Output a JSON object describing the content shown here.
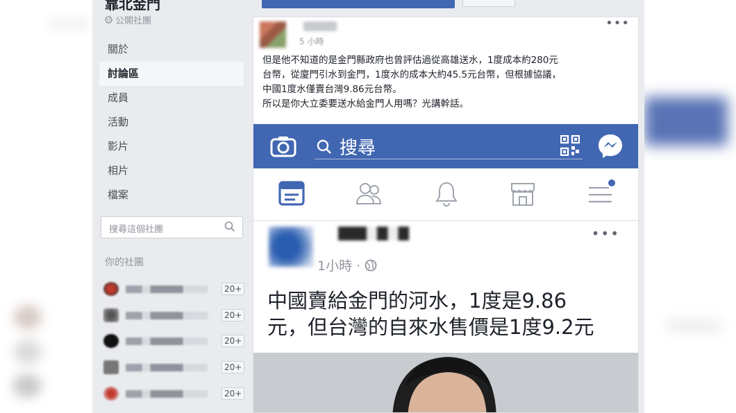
{
  "sidebar": {
    "group_title": "靠北金門",
    "group_type": "公開社團",
    "nav": [
      "關於",
      "討論區",
      "成員",
      "活動",
      "影片",
      "相片",
      "檔案"
    ],
    "search_placeholder": "搜尋這個社團",
    "your_groups_label": "你的社團",
    "groups": [
      {
        "badge": "20+"
      },
      {
        "badge": "20+"
      },
      {
        "badge": "20+"
      },
      {
        "badge": "20+"
      },
      {
        "badge": "20+"
      }
    ]
  },
  "post": {
    "time": "5 小時",
    "text": [
      "但是他不知道的是金門縣政府也曾評估過從高雄送水，1度成本約280元",
      "台幣，從廈門引水到金門，1度水的成本大約45.5元台幣，但根據協議，",
      "中國1度水僅賣台灣9.86元台幣。",
      "所以是你大立委要送水給金門人用嗎？光講幹話。"
    ]
  },
  "mobile": {
    "search_label": "搜尋",
    "post_time": "1小時 ·",
    "headline": [
      "中國賣給金門的河水，1度是9.86",
      "元，但台灣的自來水售價是1度9.2元"
    ]
  },
  "colors": {
    "facebook_blue": "#4267b2",
    "panel_bg": "#e9ebee",
    "text_dark": "#1d2129",
    "text_muted": "#90949c"
  }
}
